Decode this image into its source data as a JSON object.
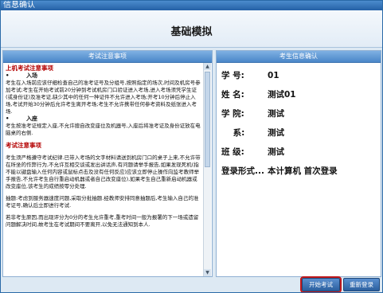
{
  "window": {
    "title": "信息确认",
    "heading": "基础模拟"
  },
  "notice_panel": {
    "header": "考试注意事项",
    "section1_title": "上机考试注意事项",
    "sub1_bullet": "•",
    "sub1_title": "入场",
    "sub1_text": "考生在入场前应该仔细检查自己的准考证号及分组号,按照指定的场次,时间及机房号参加考试;考生在开始考试前20分钟到考试机房门口验证进入考场,进入考场须凭学生证(或身份证)及准考证,缺少其中的任何一种证件不允许进入考场;开考10分钟后停止入场,考试开始30分钟后允许考生离开考场;考生不允许携带任何参考资料及纸张进入考场.",
    "sub2_bullet": "•",
    "sub2_title": "入座",
    "sub2_text": "考生按准考证规定入座,不允许擅自改变座位及机器号,入座后将准考证及身份证放在电脑桌的右侧.",
    "section2_title": "考试注意事项",
    "para1": "考生须严格遵守考试纪律.已带入考场的文字材料请送到机房门口的桌子上来,不允许带在所坐的作弊行为,不允许互相交谈或发出讲话声,有问题请举手报告,如果发现死机(指不能以键盘输入任何内容或鼠标点击及没有任何反应)应该立即停止操作向监考教师举手报告,不允许考生自行重启动机器或者自己改变座位),如果考生自己重新启动机器或改变座位,该考生的成绩按零分处理.",
    "para2": "抽题:考虑到服务器速度问题,采取分批抽题.经教师安排同意抽题后,考生输入自己的准考证号,确认后立即进行考试.",
    "para3": "若非考生原因,而出现评分为0分的考生允许重考,重考时间一般为报署的下一场或遗留问题解决时间,故考生在考试期间不要离开,以免无法通知到本人."
  },
  "info_panel": {
    "header": "考生信息确认",
    "rows": [
      {
        "label": "学  号:",
        "value": "01"
      },
      {
        "label": "姓  名:",
        "value": "测试01"
      },
      {
        "label": "学  院:",
        "value": "测试"
      },
      {
        "label": "    系:",
        "value": "测试"
      },
      {
        "label": "班  级:",
        "value": "测试"
      },
      {
        "label": "登录形式...",
        "value": "本计算机 首次登录"
      }
    ]
  },
  "buttons": {
    "start": "开始考试",
    "reenter": "重新登录"
  },
  "icons": {
    "scroll_up": "▲",
    "scroll_down": "▼"
  },
  "colors": {
    "title_bar": "#2561a6",
    "panel_header": "#4a86c8",
    "section_heading": "#b40000",
    "start_button_highlight": "#c0181c"
  }
}
